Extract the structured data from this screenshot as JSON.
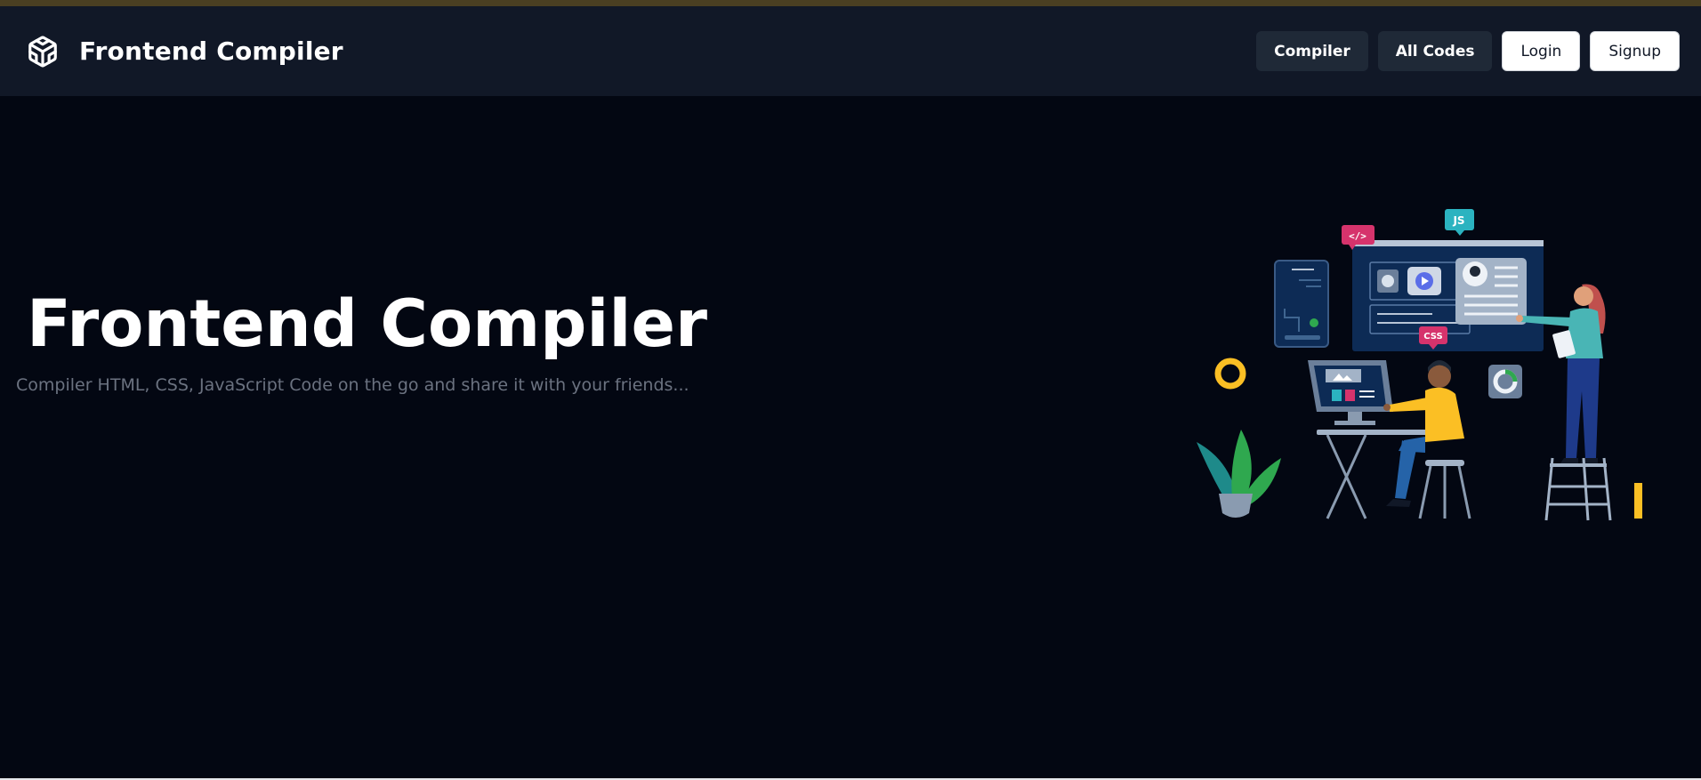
{
  "header": {
    "brand_name": "Frontend Compiler",
    "brand_icon": "codesandbox-cube-icon",
    "nav": {
      "compiler_label": "Compiler",
      "all_codes_label": "All Codes",
      "login_label": "Login",
      "signup_label": "Signup"
    }
  },
  "hero": {
    "title": "Frontend Compiler",
    "subtitle": "Compiler HTML, CSS, JavaScript Code on the go and share it with your friends...",
    "illustration": {
      "html_tag": "</>",
      "js_tag": "JS",
      "css_tag": "CSS"
    }
  },
  "colors": {
    "page_bg": "#030712",
    "navbar_bg": "#111827",
    "dark_button_bg": "#1f2937",
    "light_button_bg": "#ffffff",
    "subtitle_text": "#6b7280",
    "accent_yellow": "#fbbf24",
    "accent_pink": "#d6336c",
    "accent_teal": "#2bb3c0"
  }
}
